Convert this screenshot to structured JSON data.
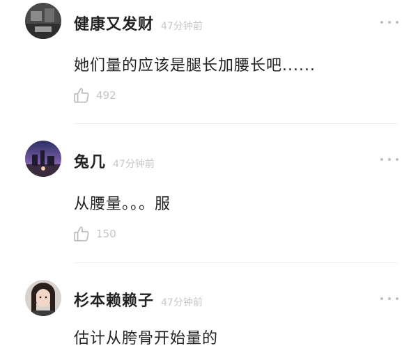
{
  "comments": [
    {
      "username": "健康又发财",
      "time": "47分钟前",
      "text": "她们量的应该是腿长加腰长吧......",
      "likes": "492"
    },
    {
      "username": "兔几",
      "time": "47分钟前",
      "text": "从腰量。。。服",
      "likes": "150"
    },
    {
      "username": "杉本赖赖子",
      "time": "47分钟前",
      "text": "估计从胯骨开始量的"
    }
  ],
  "icons": {
    "like": "thumbs-up-icon",
    "more": "more-dots-icon"
  }
}
